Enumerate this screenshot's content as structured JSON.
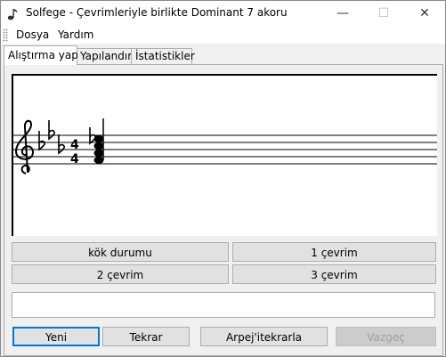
{
  "window": {
    "title": "Solfege - Çevrimleriyle birlikte Dominant 7 akoru",
    "minimize_glyph": "—",
    "maximize_glyph": "☐",
    "close_glyph": "✕"
  },
  "menu": {
    "items": [
      {
        "label": "Dosya"
      },
      {
        "label": "Yardım"
      }
    ]
  },
  "tabs": [
    {
      "label": "Alıştırma yap",
      "active": true
    },
    {
      "label": "Yapılandır"
    },
    {
      "label": "İstatistikler"
    }
  ],
  "staff": {
    "clef": "treble",
    "key_signature": "E♭ major (3 flats)",
    "time_signature": {
      "top": "4",
      "bottom": "4"
    },
    "chord_notes": [
      "E♭4",
      "G4",
      "B♭4",
      "D♭5"
    ]
  },
  "answers": [
    {
      "label": "kök durumu"
    },
    {
      "label": "1 çevrim"
    },
    {
      "label": "2 çevrim"
    },
    {
      "label": "3 çevrim"
    }
  ],
  "feedback": {
    "text": ""
  },
  "actions": {
    "new": "Yeni",
    "repeat": "Tekrar",
    "arpeggio": "Arpej'itekrarla",
    "cancel": "Vazgeç"
  },
  "colors": {
    "focus_border": "#0078d7",
    "button_face": "#e1e1e1",
    "window_bg": "#f0f0f0"
  }
}
